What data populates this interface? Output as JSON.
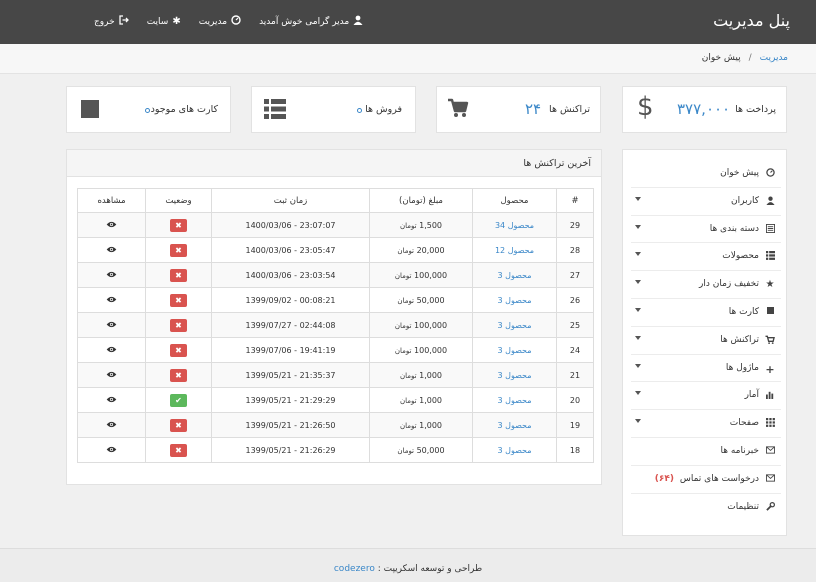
{
  "header": {
    "title": "پنل مدیریت",
    "nav": [
      {
        "label": "مدیر گرامی خوش آمدید",
        "icon": "user-icon"
      },
      {
        "label": "مدیریت",
        "icon": "dashboard-icon"
      },
      {
        "label": "سایت",
        "icon": "asterisk-icon"
      },
      {
        "label": "خروج",
        "icon": "logout-icon"
      }
    ]
  },
  "breadcrumb": {
    "home": "مدیریت",
    "separator": "/",
    "current": "پیش خوان"
  },
  "stats": {
    "payments": {
      "label": "پرداخت ها",
      "value": "۳۷۷,۰۰۰",
      "icon": "dollar-icon"
    },
    "transactions": {
      "label": "تراکنش ها",
      "value": "۲۴",
      "icon": "cart-icon"
    },
    "sales": {
      "label": "فروش ها",
      "value": "",
      "icon": "list-icon"
    },
    "cards": {
      "label": "کارت های موجود",
      "value": "",
      "icon": "square-icon"
    }
  },
  "sidebar": {
    "items": [
      {
        "label": "پیش خوان",
        "icon": "dashboard-icon",
        "caret": false
      },
      {
        "label": "کاربران",
        "icon": "user-icon",
        "caret": true
      },
      {
        "label": "دسته بندی ها",
        "icon": "list-alt-icon",
        "caret": true
      },
      {
        "label": "محصولات",
        "icon": "th-list-icon",
        "caret": true
      },
      {
        "label": "تخفیف زمان دار",
        "icon": "star-icon",
        "caret": true
      },
      {
        "label": "کارت ها",
        "icon": "stop-icon",
        "caret": true
      },
      {
        "label": "تراکنش ها",
        "icon": "cart-icon",
        "caret": true
      },
      {
        "label": "ماژول ها",
        "icon": "plus-icon",
        "caret": true
      },
      {
        "label": "آمار",
        "icon": "stats-icon",
        "caret": true
      },
      {
        "label": "صفحات",
        "icon": "grid-icon",
        "caret": true
      },
      {
        "label": "خبرنامه ها",
        "icon": "envelope-icon",
        "caret": false
      },
      {
        "label": "درخواست های تماس",
        "count": "(۶۴)",
        "icon": "envelope-icon",
        "caret": false
      },
      {
        "label": "تنظیمات",
        "icon": "wrench-icon",
        "caret": false
      }
    ]
  },
  "panel": {
    "title": "آخرین تراکنش ها",
    "columns": [
      "#",
      "محصول",
      "مبلغ (تومان)",
      "زمان ثبت",
      "وضعیت",
      "مشاهده"
    ],
    "rows": [
      {
        "id": "29",
        "product": "محصول 34",
        "amount": "1,500",
        "unit": "تومان",
        "time": "1400/03/06 - 23:07:07",
        "status": "no"
      },
      {
        "id": "28",
        "product": "محصول 12",
        "amount": "20,000",
        "unit": "تومان",
        "time": "1400/03/06 - 23:05:47",
        "status": "no"
      },
      {
        "id": "27",
        "product": "محصول 3",
        "amount": "100,000",
        "unit": "تومان",
        "time": "1400/03/06 - 23:03:54",
        "status": "no"
      },
      {
        "id": "26",
        "product": "محصول 3",
        "amount": "50,000",
        "unit": "تومان",
        "time": "1399/09/02 - 00:08:21",
        "status": "no"
      },
      {
        "id": "25",
        "product": "محصول 3",
        "amount": "100,000",
        "unit": "تومان",
        "time": "1399/07/27 - 02:44:08",
        "status": "no"
      },
      {
        "id": "24",
        "product": "محصول 3",
        "amount": "100,000",
        "unit": "تومان",
        "time": "1399/07/06 - 19:41:19",
        "status": "no"
      },
      {
        "id": "21",
        "product": "محصول 3",
        "amount": "1,000",
        "unit": "تومان",
        "time": "1399/05/21 - 21:35:37",
        "status": "no"
      },
      {
        "id": "20",
        "product": "محصول 3",
        "amount": "1,000",
        "unit": "تومان",
        "time": "1399/05/21 - 21:29:29",
        "status": "yes"
      },
      {
        "id": "19",
        "product": "محصول 3",
        "amount": "1,000",
        "unit": "تومان",
        "time": "1399/05/21 - 21:26:50",
        "status": "no"
      },
      {
        "id": "18",
        "product": "محصول 3",
        "amount": "50,000",
        "unit": "تومان",
        "time": "1399/05/21 - 21:26:29",
        "status": "no"
      }
    ]
  },
  "footer": {
    "text": "طراحی و توسعه اسکریپت :",
    "brand": "codezero"
  },
  "colors": {
    "topbar": "#474747",
    "accent": "#3a87c8",
    "danger": "#d9534f",
    "success": "#5cb85c"
  }
}
